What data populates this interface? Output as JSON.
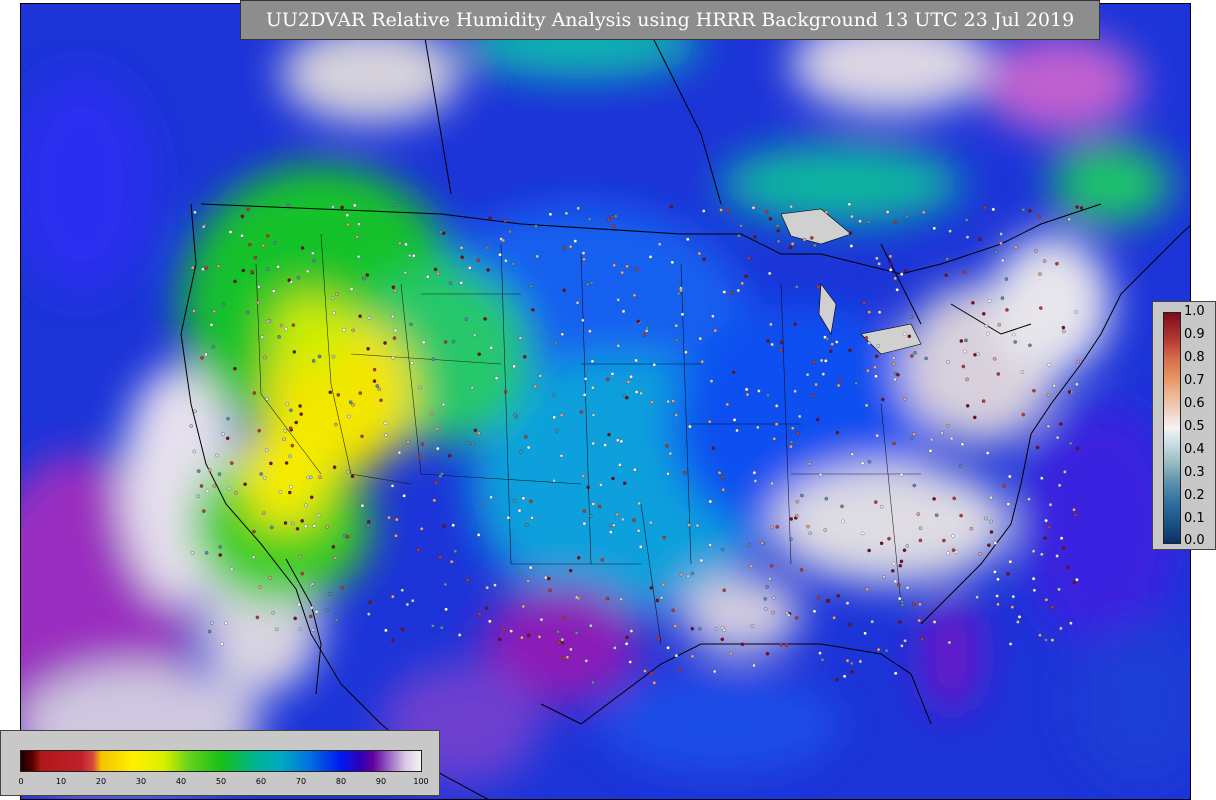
{
  "title": "UU2DVAR Relative Humidity Analysis using HRRR Background 13 UTC 23 Jul 2019",
  "rh_legend": {
    "ticks": [
      "0",
      "10",
      "20",
      "30",
      "40",
      "50",
      "60",
      "70",
      "80",
      "90",
      "100"
    ]
  },
  "qc_legend": {
    "ticks": [
      "1.0",
      "0.9",
      "0.8",
      "0.7",
      "0.6",
      "0.5",
      "0.4",
      "0.3",
      "0.2",
      "0.1",
      "0.0"
    ]
  },
  "colors": {
    "title_bg": "#8d8d8d",
    "title_fg": "#ffffff",
    "legend_bg": "#c8c8c8",
    "map_dry": "#ffe600",
    "map_moderate": "#18c41a",
    "map_humid": "#0a4af0",
    "map_saturated": "#d9d4dc",
    "border_lines": "#000000"
  }
}
